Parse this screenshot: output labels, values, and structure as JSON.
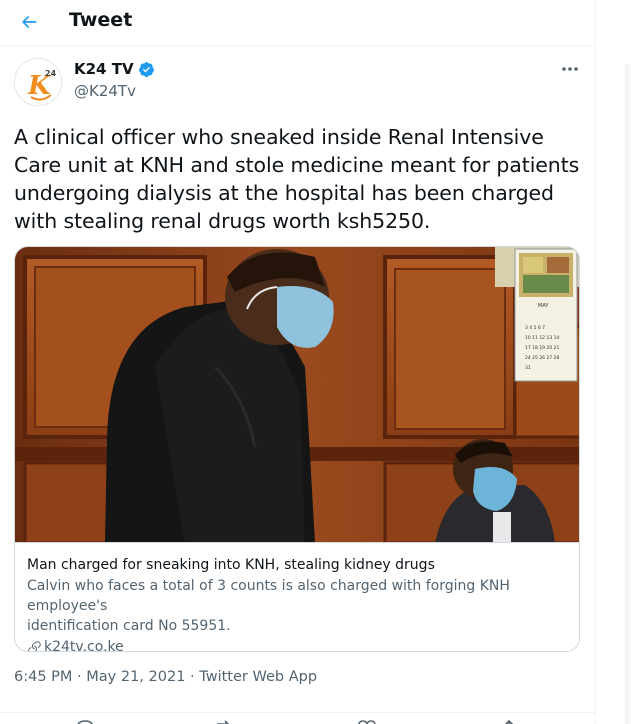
{
  "header": {
    "title": "Tweet"
  },
  "author": {
    "name": "K24 TV",
    "handle": "@K24Tv",
    "verified": true,
    "avatar_text": "K",
    "avatar_sup": "24"
  },
  "tweet": {
    "lines": [
      "A clinical officer who sneaked inside Renal Intensive",
      "Care unit at KNH and stole medicine meant for patients",
      "undergoing dialysis at the hospital has been charged",
      "with stealing renal drugs worth ksh5250."
    ]
  },
  "card": {
    "title": "Man charged for sneaking into KNH, stealing kidney drugs",
    "description_lines": [
      "Calvin who faces a total of 3 counts is also charged with forging KNH employee's",
      "identification card No 55951."
    ],
    "domain": "k24tv.co.ke",
    "calendar": {
      "month": "MAY"
    }
  },
  "meta": {
    "time": "6:45 PM",
    "sep": " · ",
    "date": "May 21, 2021",
    "source": "Twitter Web App"
  },
  "colors": {
    "accent": "#1d9bf0",
    "text": "#0f1419",
    "secondary": "#536471",
    "border": "#cfd9de"
  },
  "icons": [
    "back-arrow-icon",
    "verified-badge-icon",
    "more-icon",
    "link-icon",
    "reply-icon",
    "retweet-icon",
    "like-icon",
    "share-icon"
  ]
}
